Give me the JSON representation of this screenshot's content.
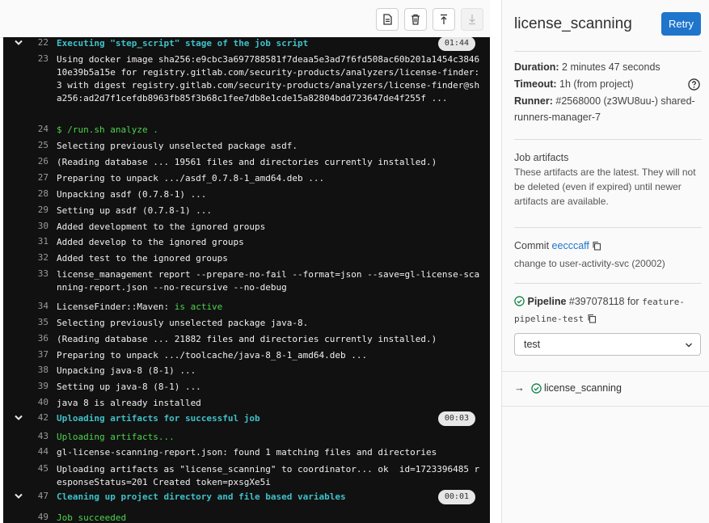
{
  "toolbar": {
    "buttons": [
      {
        "name": "show-raw-icon"
      },
      {
        "name": "erase-log-icon"
      },
      {
        "name": "scroll-to-top-icon"
      },
      {
        "name": "scroll-to-bottom-icon"
      }
    ]
  },
  "log": {
    "lines": [
      {
        "n": "22",
        "text": "Executing \"step_script\" stage of the job script",
        "style": "section",
        "collapsible": true,
        "duration": "01:44"
      },
      {
        "n": "23",
        "text": "Using docker image sha256:e9cbc3a697788581f7deaa5e3ad7f6fd508ac60b201a1454c384610e39b5a15e for registry.gitlab.com/security-products/analyzers/license-finder:3 with digest registry.gitlab.com/security-products/analyzers/license-finder@sha256:ad2d7f1cefdb8963fb85f3b68c1fee7db8e1cde15a82804bdd723647de4f255f ...",
        "style": "normal"
      },
      {
        "n": "24",
        "text": "$ /run.sh analyze .",
        "style": "command"
      },
      {
        "n": "25",
        "text": "Selecting previously unselected package asdf.",
        "style": "normal"
      },
      {
        "n": "26",
        "text": "(Reading database ... 19561 files and directories currently installed.)",
        "style": "normal"
      },
      {
        "n": "27",
        "text": "Preparing to unpack .../asdf_0.7.8-1_amd64.deb ...",
        "style": "normal"
      },
      {
        "n": "28",
        "text": "Unpacking asdf (0.7.8-1) ...",
        "style": "normal"
      },
      {
        "n": "29",
        "text": "Setting up asdf (0.7.8-1) ...",
        "style": "normal"
      },
      {
        "n": "30",
        "text": "Added development to the ignored groups",
        "style": "normal"
      },
      {
        "n": "31",
        "text": "Added develop to the ignored groups",
        "style": "normal"
      },
      {
        "n": "32",
        "text": "Added test to the ignored groups",
        "style": "normal"
      },
      {
        "n": "33",
        "text": "license_management report --prepare-no-fail --format=json --save=gl-license-scanning-report.json --no-recursive --no-debug",
        "style": "normal"
      },
      {
        "n": "34",
        "text": "LicenseFinder::Maven: ",
        "suffix": "is active",
        "style": "normal"
      },
      {
        "n": "35",
        "text": "Selecting previously unselected package java-8.",
        "style": "normal"
      },
      {
        "n": "36",
        "text": "(Reading database ... 21882 files and directories currently installed.)",
        "style": "normal"
      },
      {
        "n": "37",
        "text": "Preparing to unpack .../toolcache/java-8_8-1_amd64.deb ...",
        "style": "normal"
      },
      {
        "n": "38",
        "text": "Unpacking java-8 (8-1) ...",
        "style": "normal"
      },
      {
        "n": "39",
        "text": "Setting up java-8 (8-1) ...",
        "style": "normal"
      },
      {
        "n": "40",
        "text": "java 8 is already installed",
        "style": "normal"
      },
      {
        "n": "42",
        "text": "Uploading artifacts for successful job",
        "style": "section",
        "collapsible": true,
        "duration": "00:03"
      },
      {
        "n": "43",
        "text": "Uploading artifacts...",
        "style": "command"
      },
      {
        "n": "44",
        "text": "gl-license-scanning-report.json: found 1 matching files and directories",
        "style": "normal"
      },
      {
        "n": "45",
        "text": "Uploading artifacts as \"license_scanning\" to coordinator... ok  id=1723396485 responseStatus=201 Created token=pxsgXe5i",
        "style": "normal"
      },
      {
        "n": "47",
        "text": "Cleaning up project directory and file based variables",
        "style": "section",
        "collapsible": true,
        "duration": "00:01"
      },
      {
        "n": "49",
        "text": "Job succeeded",
        "style": "command"
      }
    ]
  },
  "sidebar": {
    "job_name": "license_scanning",
    "retry_label": "Retry",
    "duration_label": "Duration:",
    "duration_value": "2 minutes 47 seconds",
    "timeout_label": "Timeout:",
    "timeout_value": "1h (from project)",
    "runner_label": "Runner:",
    "runner_value": "#2568000 (z3WU8uu-) shared-runners-manager-7",
    "artifacts_title": "Job artifacts",
    "artifacts_text": "These artifacts are the latest. They will not be deleted (even if expired) until newer artifacts are available.",
    "commit_label": "Commit",
    "commit_sha": "eecccaff",
    "commit_message": "change to user-activity-svc (20002)",
    "pipeline_label": "Pipeline",
    "pipeline_id": "#397078118",
    "pipeline_for": "for",
    "pipeline_branch": "feature-pipeline-test",
    "stage_select": "test",
    "current_job": "license_scanning",
    "arrow": "→"
  },
  "colors": {
    "section": "#3fc1c9",
    "command": "#4dd44d",
    "retry": "#1f75cb",
    "success": "#108548"
  }
}
